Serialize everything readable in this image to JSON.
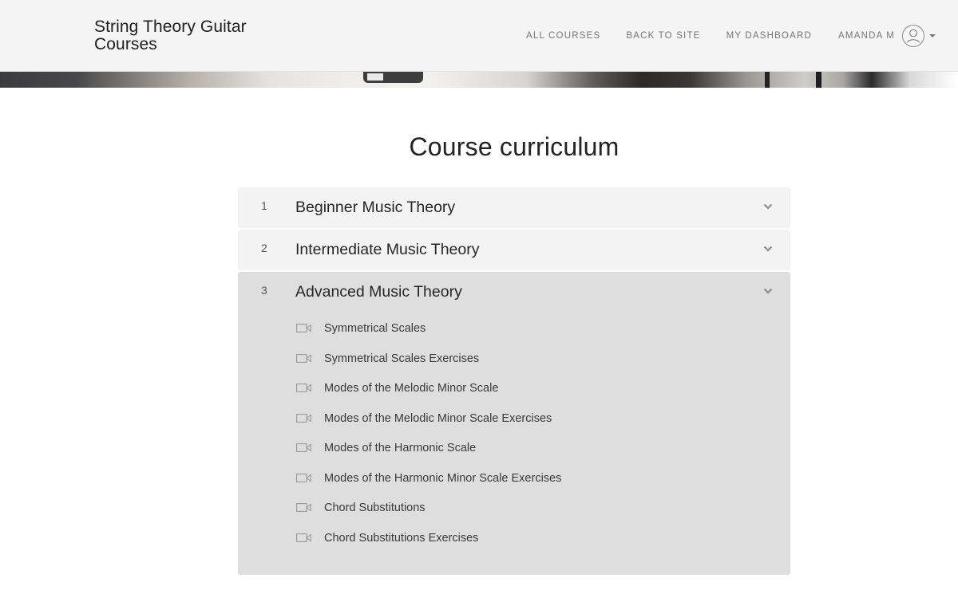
{
  "header": {
    "brand": "String Theory Guitar Courses",
    "nav": [
      "ALL COURSES",
      "BACK TO SITE",
      "MY DASHBOARD"
    ],
    "user_name": "AMANDA M",
    "user_icon": "user-avatar-icon"
  },
  "main": {
    "title": "Course curriculum",
    "sections": [
      {
        "number": "1",
        "title": "Beginner Music Theory",
        "expanded": false
      },
      {
        "number": "2",
        "title": "Intermediate Music Theory",
        "expanded": false
      },
      {
        "number": "3",
        "title": "Advanced Music Theory",
        "expanded": true,
        "lessons": [
          {
            "icon": "video-icon",
            "title": "Symmetrical Scales"
          },
          {
            "icon": "video-icon",
            "title": "Symmetrical Scales Exercises"
          },
          {
            "icon": "video-icon",
            "title": "Modes of the Melodic Minor Scale"
          },
          {
            "icon": "video-icon",
            "title": "Modes of the Melodic Minor Scale Exercises"
          },
          {
            "icon": "video-icon",
            "title": "Modes of the Harmonic Scale"
          },
          {
            "icon": "video-icon",
            "title": "Modes of the Harmonic Minor Scale Exercises"
          },
          {
            "icon": "video-icon",
            "title": "Chord Substitutions"
          },
          {
            "icon": "video-icon",
            "title": "Chord Substitutions Exercises"
          }
        ]
      }
    ]
  },
  "colors": {
    "header_bg": "#f4f4f4",
    "section_bg": "#f3f3f3",
    "section_open_bg": "#dedede"
  }
}
